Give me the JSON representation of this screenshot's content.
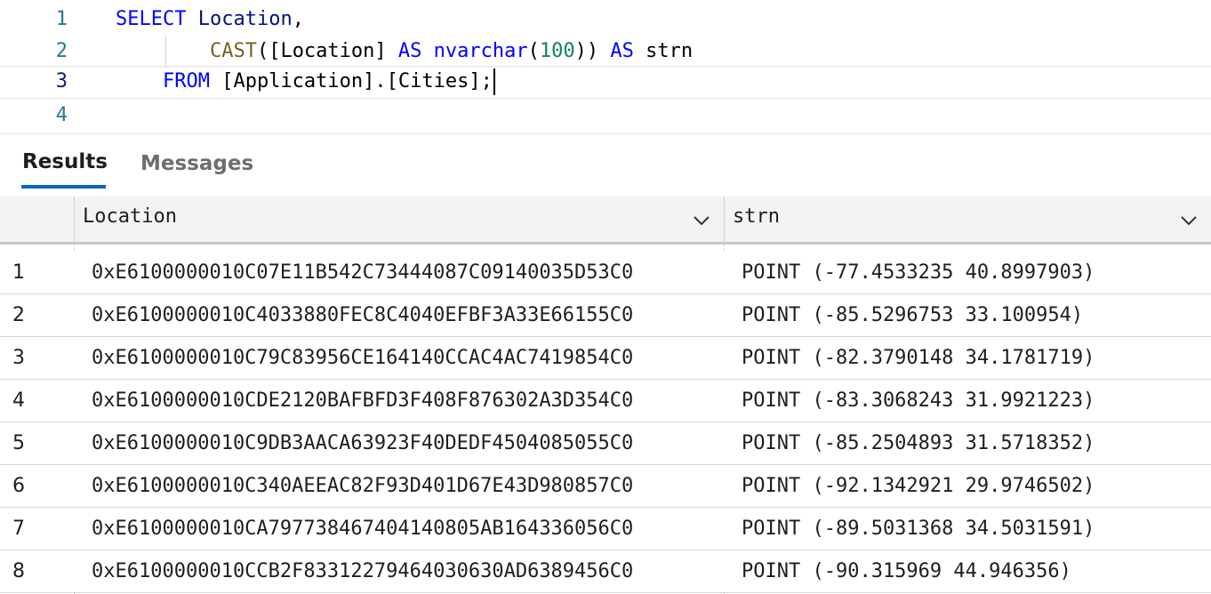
{
  "editor": {
    "lines": [
      {
        "number": "1",
        "tokens": [
          {
            "text": "SELECT",
            "cls": "kw"
          },
          {
            "text": " ",
            "cls": "plain"
          },
          {
            "text": "Location",
            "cls": "ident"
          },
          {
            "text": ",",
            "cls": "plain"
          }
        ]
      },
      {
        "number": "2",
        "tokens": [
          {
            "text": "        ",
            "cls": "plain"
          },
          {
            "text": "CAST",
            "cls": "fn"
          },
          {
            "text": "([Location] ",
            "cls": "plain"
          },
          {
            "text": "AS",
            "cls": "kw"
          },
          {
            "text": " ",
            "cls": "plain"
          },
          {
            "text": "nvarchar",
            "cls": "kw"
          },
          {
            "text": "(",
            "cls": "plain"
          },
          {
            "text": "100",
            "cls": "num"
          },
          {
            "text": ")) ",
            "cls": "plain"
          },
          {
            "text": "AS",
            "cls": "kw"
          },
          {
            "text": " strn",
            "cls": "plain"
          }
        ]
      },
      {
        "number": "3",
        "tokens": [
          {
            "text": "    ",
            "cls": "plain"
          },
          {
            "text": "FROM",
            "cls": "kw"
          },
          {
            "text": " [Application].[Cities];",
            "cls": "plain"
          }
        ]
      },
      {
        "number": "4",
        "tokens": []
      }
    ]
  },
  "tabs": {
    "results_label": "Results",
    "messages_label": "Messages",
    "active": "Results"
  },
  "grid": {
    "columns": [
      "Location",
      "strn"
    ],
    "rows": [
      {
        "num": "1",
        "location": "0xE6100000010C07E11B542C73444087C09140035D53C0",
        "strn": "POINT (-77.4533235 40.8997903)"
      },
      {
        "num": "2",
        "location": "0xE6100000010C4033880FEC8C4040EFBF3A33E66155C0",
        "strn": "POINT (-85.5296753 33.100954)"
      },
      {
        "num": "3",
        "location": "0xE6100000010C79C83956CE164140CCAC4AC7419854C0",
        "strn": "POINT (-82.3790148 34.1781719)"
      },
      {
        "num": "4",
        "location": "0xE6100000010CDE2120BAFBFD3F408F876302A3D354C0",
        "strn": "POINT (-83.3068243 31.9921223)"
      },
      {
        "num": "5",
        "location": "0xE6100000010C9DB3AACA63923F40DEDF4504085055C0",
        "strn": "POINT (-85.2504893 31.5718352)"
      },
      {
        "num": "6",
        "location": "0xE6100000010C340AEEAC82F93D401D67E43D980857C0",
        "strn": "POINT (-92.1342921 29.9746502)"
      },
      {
        "num": "7",
        "location": "0xE6100000010CA797738467404140805AB164336056C0",
        "strn": "POINT (-89.5031368 34.5031591)"
      },
      {
        "num": "8",
        "location": "0xE6100000010CCB2F83312279464030630AD6389456C0",
        "strn": "POINT (-90.315969 44.946356)"
      }
    ]
  },
  "colors": {
    "keyword": "#0000ff",
    "function": "#795e26",
    "number": "#098658",
    "identifier": "#001080",
    "line_number": "#237893",
    "active_tab_underline": "#0066bf"
  }
}
